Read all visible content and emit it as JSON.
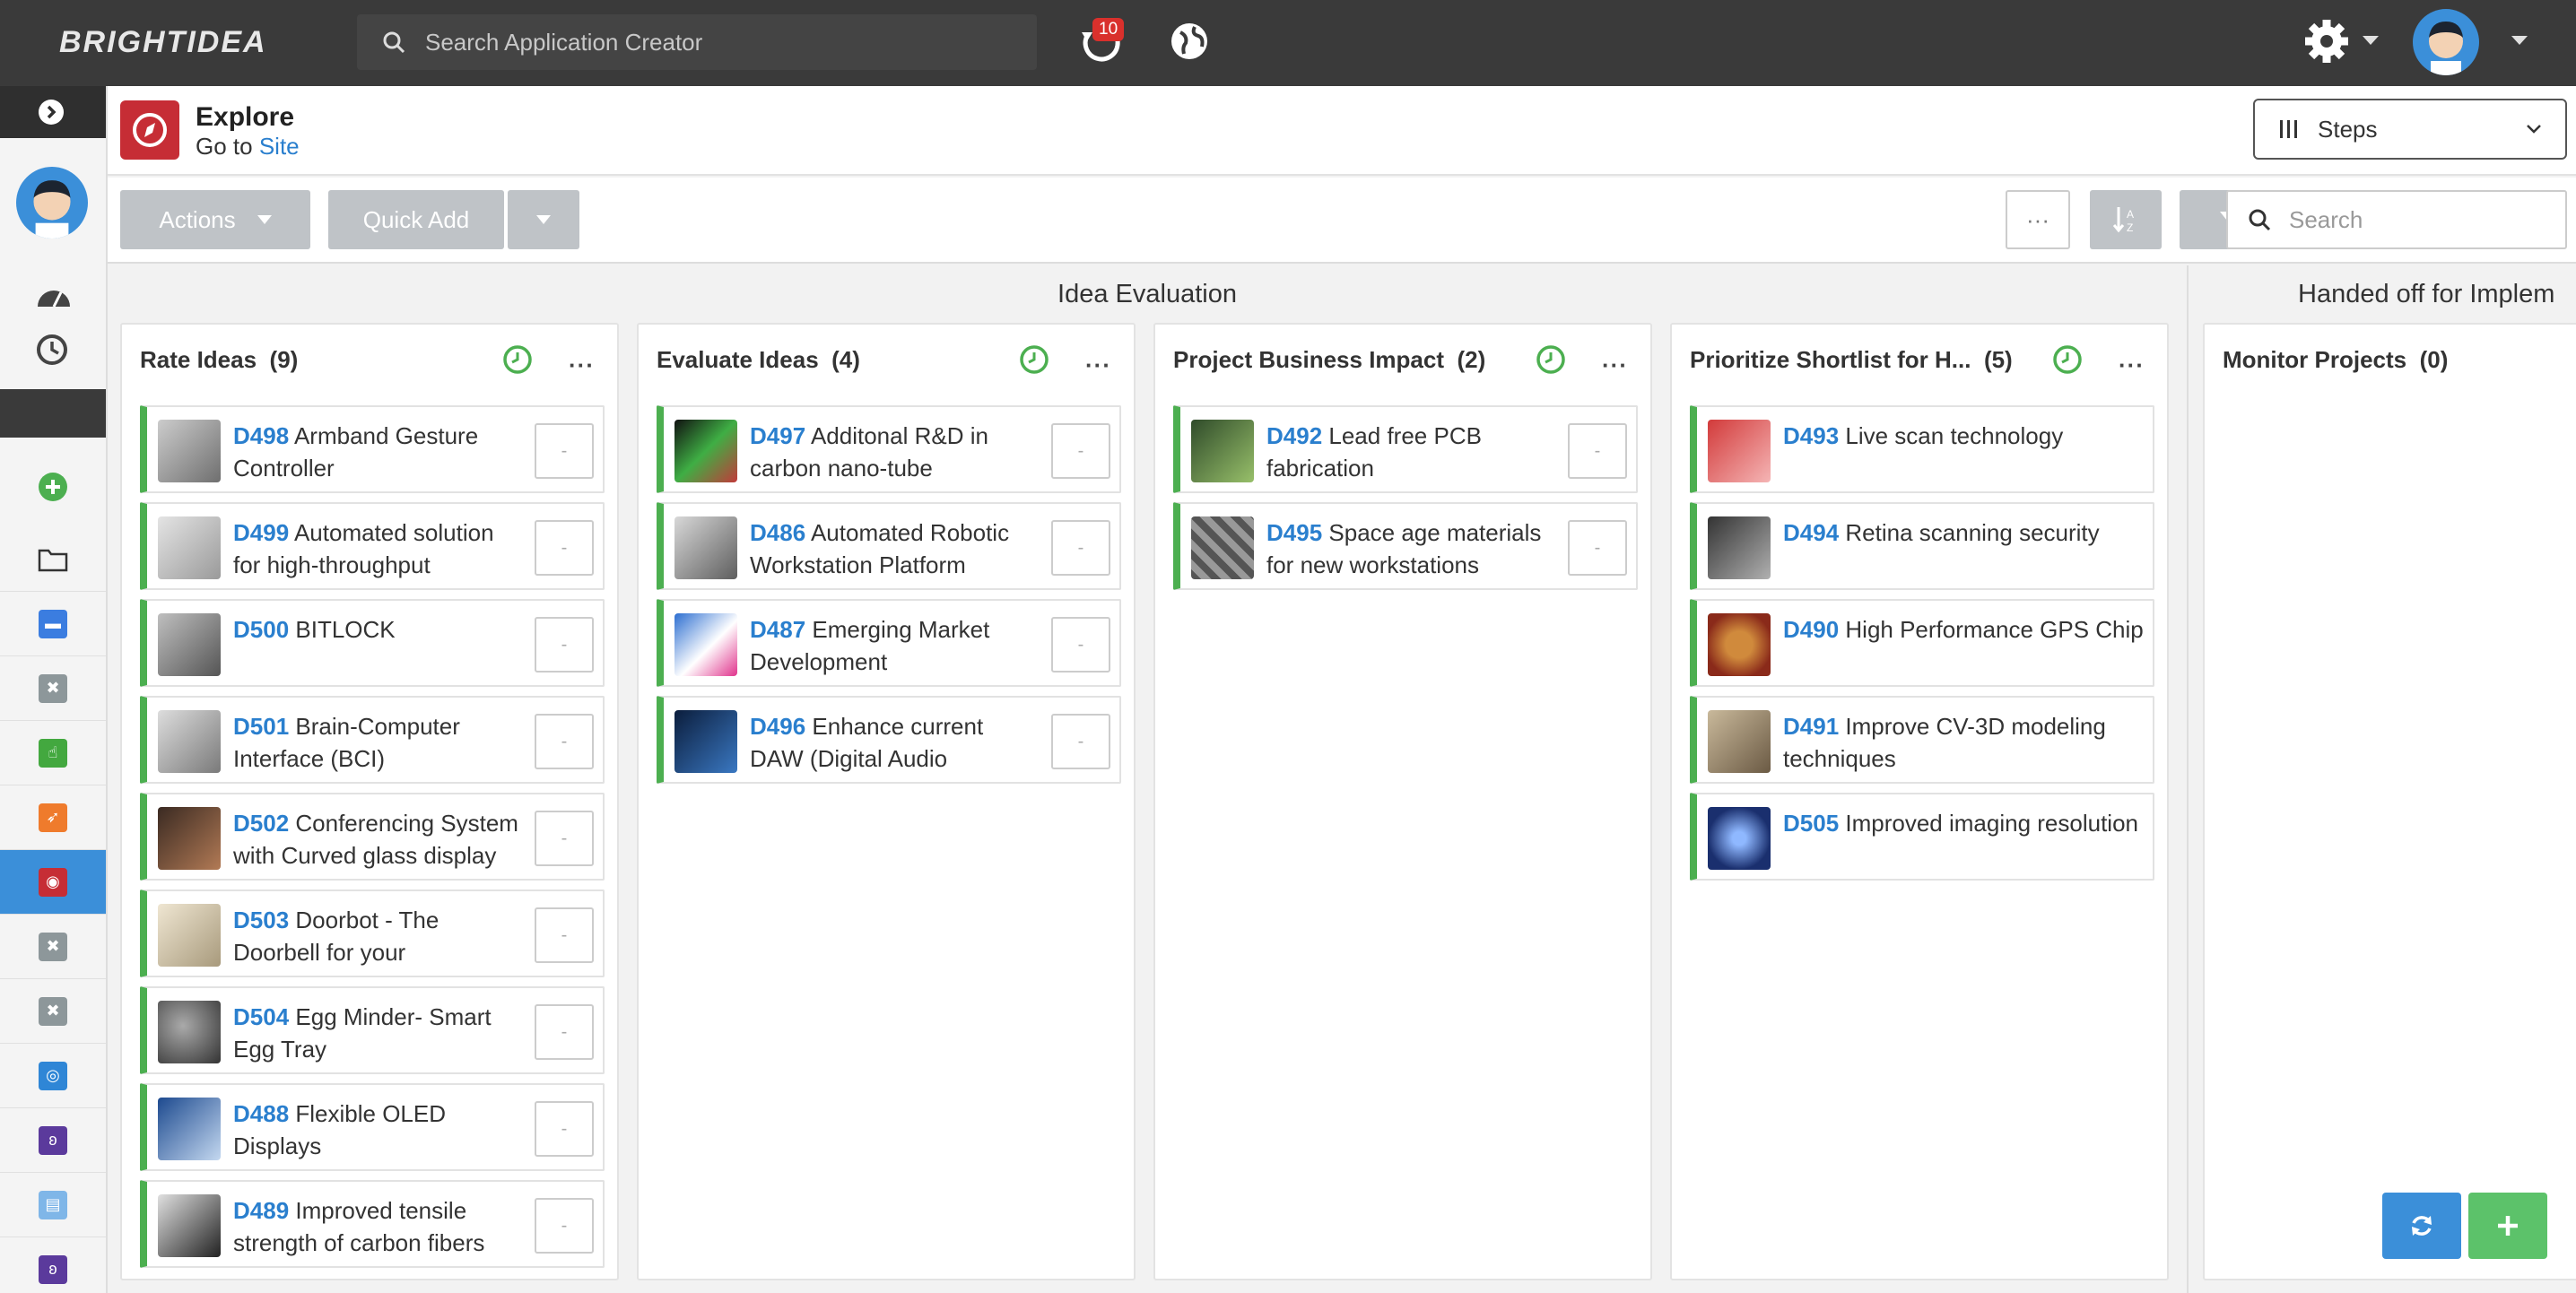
{
  "app": {
    "logo_text": "BRIGHTIDEA"
  },
  "topbar": {
    "search_placeholder": "Search Application Creator",
    "notification_count": "10"
  },
  "header": {
    "title": "Explore",
    "goto_prefix": "Go to",
    "goto_link": "Site",
    "view_select": "Steps"
  },
  "toolbar": {
    "actions_label": "Actions",
    "quick_add_label": "Quick Add",
    "more_label": "···",
    "search_placeholder": "Search"
  },
  "groups": [
    {
      "title": "Idea Evaluation"
    },
    {
      "title": "Handed off for Implem"
    }
  ],
  "columns": [
    {
      "name": "Rate Ideas",
      "count": "(9)",
      "cards": [
        {
          "id": "D498",
          "title": "Armband Gesture Controller",
          "score": "-"
        },
        {
          "id": "D499",
          "title": "Automated solution for high-throughput",
          "score": "-"
        },
        {
          "id": "D500",
          "title": "BITLOCK",
          "score": "-"
        },
        {
          "id": "D501",
          "title": "Brain-Computer Interface (BCI)",
          "score": "-"
        },
        {
          "id": "D502",
          "title": "Conferencing System with Curved glass display",
          "score": "-"
        },
        {
          "id": "D503",
          "title": "Doorbot - The Doorbell for your",
          "score": "-"
        },
        {
          "id": "D504",
          "title": "Egg Minder- Smart Egg Tray",
          "score": "-"
        },
        {
          "id": "D488",
          "title": "Flexible OLED Displays",
          "score": "-"
        },
        {
          "id": "D489",
          "title": "Improved tensile strength of carbon fibers",
          "score": "-"
        }
      ]
    },
    {
      "name": "Evaluate Ideas",
      "count": "(4)",
      "cards": [
        {
          "id": "D497",
          "title": "Additonal R&D in carbon nano-tube",
          "score": "-"
        },
        {
          "id": "D486",
          "title": "Automated Robotic Workstation Platform",
          "score": "-"
        },
        {
          "id": "D487",
          "title": "Emerging Market Development",
          "score": "-"
        },
        {
          "id": "D496",
          "title": "Enhance current DAW (Digital Audio",
          "score": "-"
        }
      ]
    },
    {
      "name": "Project Business Impact",
      "count": "(2)",
      "cards": [
        {
          "id": "D492",
          "title": "Lead free PCB fabrication",
          "score": "-"
        },
        {
          "id": "D495",
          "title": "Space age materials for new workstations",
          "score": "-"
        }
      ]
    },
    {
      "name": "Prioritize Shortlist for H...",
      "count": "(5)",
      "cards": [
        {
          "id": "D493",
          "title": "Live scan technology"
        },
        {
          "id": "D494",
          "title": "Retina scanning security"
        },
        {
          "id": "D490",
          "title": "High Performance GPS Chip"
        },
        {
          "id": "D491",
          "title": "Improve CV-3D modeling techniques"
        },
        {
          "id": "D505",
          "title": "Improved imaging resolution"
        }
      ]
    },
    {
      "name": "Monitor Projects",
      "count": "(0)",
      "cards": []
    }
  ],
  "colors": {
    "accent": "#3b8fd9",
    "link": "#2a7fce",
    "card_border": "#4caf50",
    "fab_refresh": "#3b8fd9",
    "fab_add": "#5cc26a",
    "explore": "#c62d35"
  }
}
